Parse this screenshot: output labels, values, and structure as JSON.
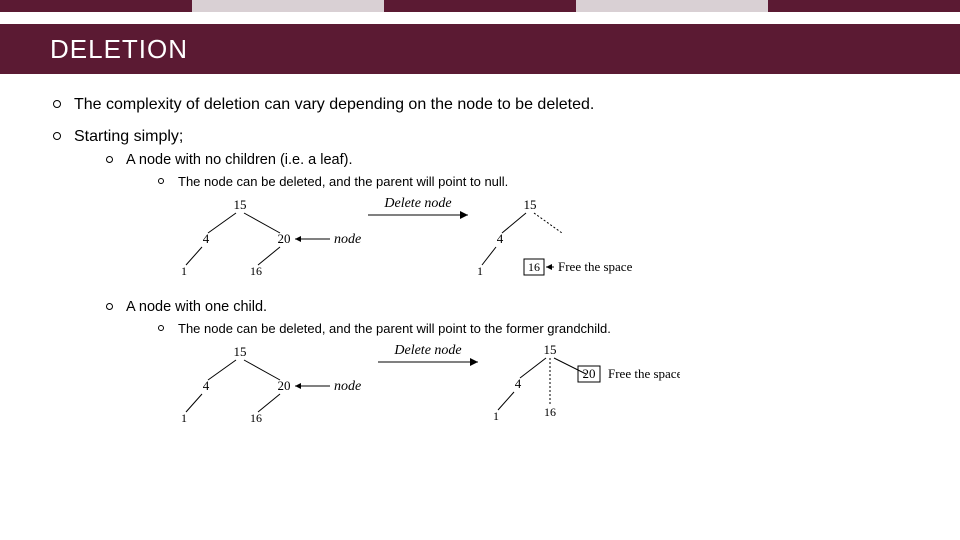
{
  "title": "DELETION",
  "bullets": {
    "b1": "The complexity of deletion can vary depending on the node to be deleted.",
    "b2": "Starting simply;",
    "b2a": "A node with no children (i.e. a leaf).",
    "b2a1": "The node can be deleted, and the parent will point to null.",
    "b2b": "A node with one child.",
    "b2b1": "The node can be deleted, and the parent will point to the former grandchild."
  },
  "diagram1": {
    "deleteLabel": "Delete node",
    "nodeLabel": "node",
    "freeLabel": "Free the space",
    "before": {
      "root": "15",
      "left": "4",
      "lleft": "1",
      "right": "20",
      "rleft": "16"
    },
    "after": {
      "root": "15",
      "left": "4",
      "lleft": "1",
      "rleft": "16"
    }
  },
  "diagram2": {
    "deleteLabel": "Delete node",
    "nodeLabel": "node",
    "freeLabel": "Free the space",
    "before": {
      "root": "15",
      "left": "4",
      "lleft": "1",
      "right": "20",
      "rleft": "16"
    },
    "after": {
      "root": "15",
      "left": "4",
      "lleft": "1",
      "right": "20",
      "rleft": "16"
    }
  }
}
